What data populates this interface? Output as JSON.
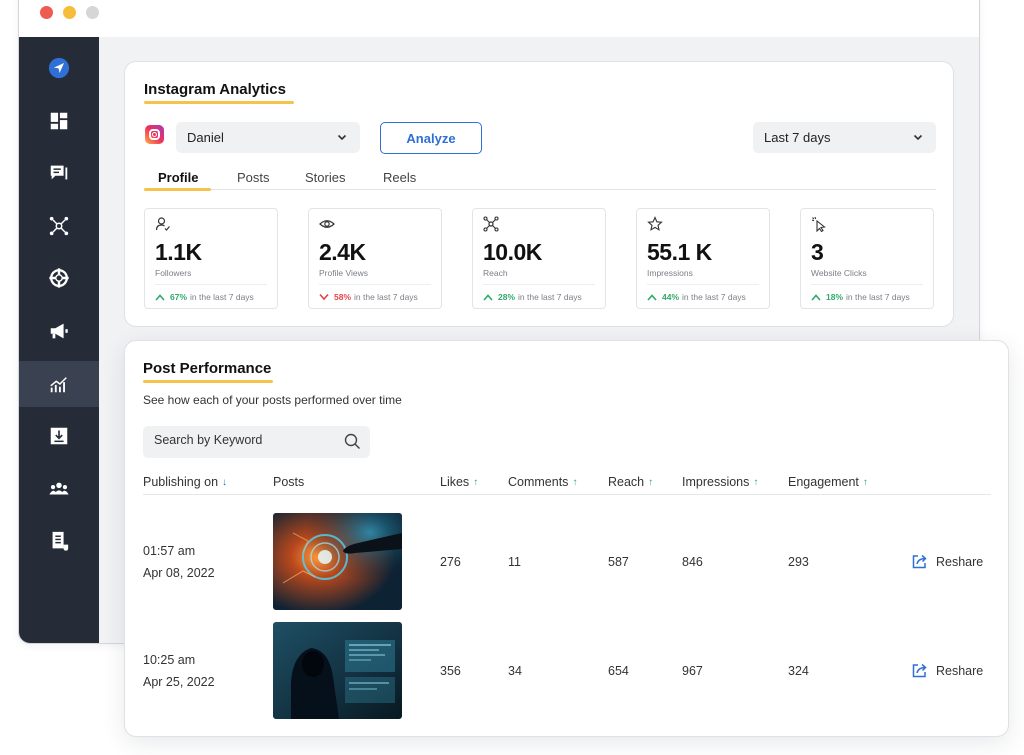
{
  "sidebar": {
    "items": [
      {
        "icon": "send-icon"
      },
      {
        "icon": "dashboard-icon"
      },
      {
        "icon": "chat-icon"
      },
      {
        "icon": "network-icon"
      },
      {
        "icon": "lifebuoy-icon"
      },
      {
        "icon": "megaphone-icon"
      },
      {
        "icon": "analytics-icon",
        "active": true
      },
      {
        "icon": "download-icon"
      },
      {
        "icon": "team-icon"
      },
      {
        "icon": "document-icon"
      }
    ]
  },
  "analytics": {
    "title": "Instagram Analytics",
    "account_select": "Daniel",
    "analyze_label": "Analyze",
    "period_select": "Last 7 days",
    "tabs": [
      "Profile",
      "Posts",
      "Stories",
      "Reels"
    ],
    "active_tab": "Profile",
    "metrics": [
      {
        "icon": "user-check-icon",
        "value": "1.1K",
        "label": "Followers",
        "trend": "up",
        "pct": "67%",
        "period": "in the last 7 days"
      },
      {
        "icon": "eye-icon",
        "value": "2.4K",
        "label": "Profile Views",
        "trend": "down",
        "pct": "58%",
        "period": "in the last 7 days"
      },
      {
        "icon": "reach-icon",
        "value": "10.0K",
        "label": "Reach",
        "trend": "up",
        "pct": "28%",
        "period": "in the last 7 days"
      },
      {
        "icon": "star-icon",
        "value": "55.1 K",
        "label": "Impressions",
        "trend": "up",
        "pct": "44%",
        "period": "in the last 7 days"
      },
      {
        "icon": "cursor-click-icon",
        "value": "3",
        "label": "Website Clicks",
        "trend": "up",
        "pct": "18%",
        "period": "in the last 7 days"
      }
    ]
  },
  "performance": {
    "title": "Post Performance",
    "subtitle": "See how each of your posts performed over time",
    "search_placeholder": "Search by Keyword",
    "columns": {
      "publishing": "Publishing on",
      "posts": "Posts",
      "likes": "Likes",
      "comments": "Comments",
      "reach": "Reach",
      "impressions": "Impressions",
      "engagement": "Engagement"
    },
    "rows": [
      {
        "time": "01:57 am",
        "date": "Apr 08, 2022",
        "image": "finger-touching-digital-interface",
        "likes": "276",
        "comments": "11",
        "reach": "587",
        "impressions": "846",
        "engagement": "293",
        "action": "Reshare"
      },
      {
        "time": "10:25 am",
        "date": "Apr 25, 2022",
        "image": "hooded-hacker-at-computer",
        "likes": "356",
        "comments": "34",
        "reach": "654",
        "impressions": "967",
        "engagement": "324",
        "action": "Reshare"
      }
    ]
  },
  "colors": {
    "accent_blue": "#2f6fd6",
    "accent_yellow": "#f5c24c",
    "trend_up": "#2eaa6a",
    "trend_down": "#e2434b",
    "sidebar_bg": "#252b37"
  }
}
